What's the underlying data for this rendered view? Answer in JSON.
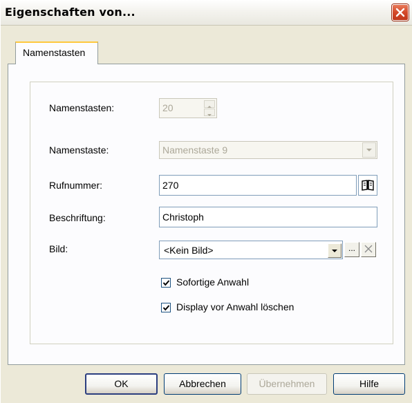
{
  "window": {
    "title": "Eigenschaften von...",
    "close_icon": "close-icon"
  },
  "tabs": [
    {
      "label": "Namenstasten",
      "active": true
    }
  ],
  "form": {
    "count_label": "Namenstasten:",
    "count_value": "20",
    "key_label": "Namenstaste:",
    "key_value": "Namenstaste 9",
    "phone_label": "Rufnummer:",
    "phone_value": "270",
    "caption_label": "Beschriftung:",
    "caption_value": "Christoph",
    "image_label": "Bild:",
    "image_value": "<Kein Bild>",
    "image_browse_label": "...",
    "checkbox_instant": {
      "label": "Sofortige Anwahl",
      "checked": true
    },
    "checkbox_clear": {
      "label": "Display vor Anwahl löschen",
      "checked": true
    }
  },
  "buttons": {
    "ok": "OK",
    "cancel": "Abbrechen",
    "apply": "Übernehmen",
    "help": "Hilfe"
  },
  "colors": {
    "close_button": "#D4492A",
    "window_bg": "#ECE9D8",
    "panel_bg": "#FCFCFE",
    "active_tab_accent": "#FFC83C",
    "disabled_text": "#ACA899"
  }
}
